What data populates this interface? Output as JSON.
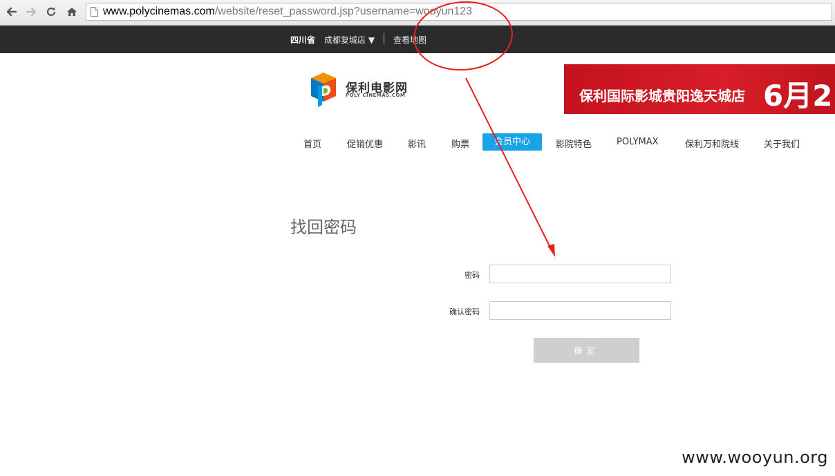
{
  "browser": {
    "url_host": "www.polycinemas.com",
    "url_path": "/website/reset_password.jsp?username=wooyun123",
    "icons": [
      "back-icon",
      "forward-icon",
      "reload-icon",
      "home-icon",
      "page-icon"
    ]
  },
  "location_bar": {
    "province": "四川省",
    "city": "成都复城店 ▼",
    "map_link": "查看地图"
  },
  "logo": {
    "name_cn": "保利电影网",
    "name_en": "POLY CINEMAS.COM"
  },
  "banner": {
    "text": "保利国际影城贵阳逸天城店",
    "date": "6月2"
  },
  "nav": {
    "items": [
      {
        "label": "首页"
      },
      {
        "label": "促销优惠"
      },
      {
        "label": "影讯"
      },
      {
        "label": "购票"
      },
      {
        "label": "会员中心"
      },
      {
        "label": "影院特色"
      },
      {
        "label": "POLYMAX"
      },
      {
        "label": "保利万和院线"
      },
      {
        "label": "关于我们"
      }
    ],
    "active_index": 4
  },
  "form": {
    "title": "找回密码",
    "password_label": "密码",
    "confirm_label": "确认密码",
    "password_value": "",
    "confirm_value": "",
    "submit_label": "确定"
  },
  "watermark": "www.wooyun.org",
  "colors": {
    "nav_active": "#1aa3e8",
    "banner": "#d81e28",
    "location_bar": "#2b2b2b",
    "annotation": "#e8201c"
  }
}
